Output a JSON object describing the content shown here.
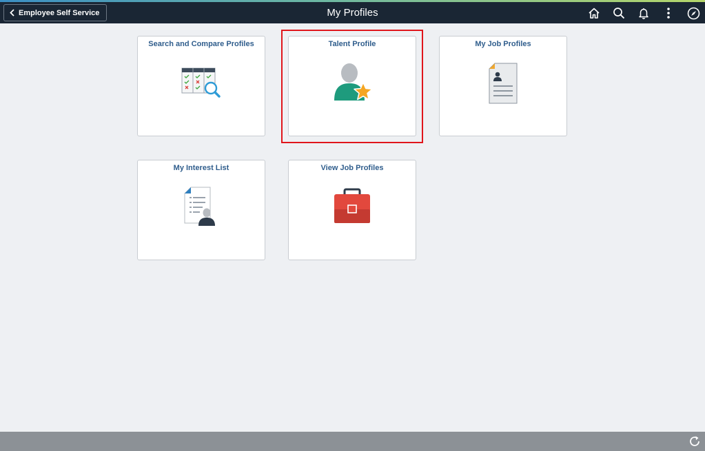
{
  "header": {
    "back_label": "Employee Self Service",
    "title": "My Profiles",
    "icons": [
      "home-icon",
      "search-icon",
      "bell-icon",
      "more-vertical-icon",
      "navbar-compass-icon"
    ]
  },
  "tiles": [
    {
      "title": "Search and Compare Profiles",
      "icon": "compare-profiles-icon"
    },
    {
      "title": "Talent Profile",
      "icon": "talent-profile-icon",
      "highlighted": true
    },
    {
      "title": "My Job Profiles",
      "icon": "job-profile-document-icon"
    },
    {
      "title": "My Interest List",
      "icon": "interest-list-icon"
    },
    {
      "title": "View Job Profiles",
      "icon": "briefcase-icon"
    }
  ],
  "footer": {
    "icon": "refresh-icon"
  },
  "colors": {
    "header_bg": "#1a2634",
    "tile_title": "#2f5d8c",
    "highlight": "#e0151b",
    "footer_bg": "#8c9196",
    "page_bg": "#eef0f3"
  }
}
